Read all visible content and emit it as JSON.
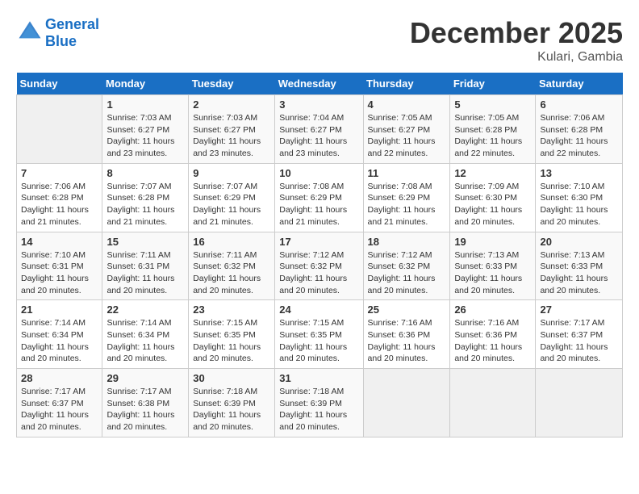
{
  "header": {
    "logo_line1": "General",
    "logo_line2": "Blue",
    "title": "December 2025",
    "subtitle": "Kulari, Gambia"
  },
  "days_of_week": [
    "Sunday",
    "Monday",
    "Tuesday",
    "Wednesday",
    "Thursday",
    "Friday",
    "Saturday"
  ],
  "weeks": [
    [
      {
        "day": "",
        "sunrise": "",
        "sunset": "",
        "daylight": ""
      },
      {
        "day": "1",
        "sunrise": "Sunrise: 7:03 AM",
        "sunset": "Sunset: 6:27 PM",
        "daylight": "Daylight: 11 hours and 23 minutes."
      },
      {
        "day": "2",
        "sunrise": "Sunrise: 7:03 AM",
        "sunset": "Sunset: 6:27 PM",
        "daylight": "Daylight: 11 hours and 23 minutes."
      },
      {
        "day": "3",
        "sunrise": "Sunrise: 7:04 AM",
        "sunset": "Sunset: 6:27 PM",
        "daylight": "Daylight: 11 hours and 23 minutes."
      },
      {
        "day": "4",
        "sunrise": "Sunrise: 7:05 AM",
        "sunset": "Sunset: 6:27 PM",
        "daylight": "Daylight: 11 hours and 22 minutes."
      },
      {
        "day": "5",
        "sunrise": "Sunrise: 7:05 AM",
        "sunset": "Sunset: 6:28 PM",
        "daylight": "Daylight: 11 hours and 22 minutes."
      },
      {
        "day": "6",
        "sunrise": "Sunrise: 7:06 AM",
        "sunset": "Sunset: 6:28 PM",
        "daylight": "Daylight: 11 hours and 22 minutes."
      }
    ],
    [
      {
        "day": "7",
        "sunrise": "Sunrise: 7:06 AM",
        "sunset": "Sunset: 6:28 PM",
        "daylight": "Daylight: 11 hours and 21 minutes."
      },
      {
        "day": "8",
        "sunrise": "Sunrise: 7:07 AM",
        "sunset": "Sunset: 6:28 PM",
        "daylight": "Daylight: 11 hours and 21 minutes."
      },
      {
        "day": "9",
        "sunrise": "Sunrise: 7:07 AM",
        "sunset": "Sunset: 6:29 PM",
        "daylight": "Daylight: 11 hours and 21 minutes."
      },
      {
        "day": "10",
        "sunrise": "Sunrise: 7:08 AM",
        "sunset": "Sunset: 6:29 PM",
        "daylight": "Daylight: 11 hours and 21 minutes."
      },
      {
        "day": "11",
        "sunrise": "Sunrise: 7:08 AM",
        "sunset": "Sunset: 6:29 PM",
        "daylight": "Daylight: 11 hours and 21 minutes."
      },
      {
        "day": "12",
        "sunrise": "Sunrise: 7:09 AM",
        "sunset": "Sunset: 6:30 PM",
        "daylight": "Daylight: 11 hours and 20 minutes."
      },
      {
        "day": "13",
        "sunrise": "Sunrise: 7:10 AM",
        "sunset": "Sunset: 6:30 PM",
        "daylight": "Daylight: 11 hours and 20 minutes."
      }
    ],
    [
      {
        "day": "14",
        "sunrise": "Sunrise: 7:10 AM",
        "sunset": "Sunset: 6:31 PM",
        "daylight": "Daylight: 11 hours and 20 minutes."
      },
      {
        "day": "15",
        "sunrise": "Sunrise: 7:11 AM",
        "sunset": "Sunset: 6:31 PM",
        "daylight": "Daylight: 11 hours and 20 minutes."
      },
      {
        "day": "16",
        "sunrise": "Sunrise: 7:11 AM",
        "sunset": "Sunset: 6:32 PM",
        "daylight": "Daylight: 11 hours and 20 minutes."
      },
      {
        "day": "17",
        "sunrise": "Sunrise: 7:12 AM",
        "sunset": "Sunset: 6:32 PM",
        "daylight": "Daylight: 11 hours and 20 minutes."
      },
      {
        "day": "18",
        "sunrise": "Sunrise: 7:12 AM",
        "sunset": "Sunset: 6:32 PM",
        "daylight": "Daylight: 11 hours and 20 minutes."
      },
      {
        "day": "19",
        "sunrise": "Sunrise: 7:13 AM",
        "sunset": "Sunset: 6:33 PM",
        "daylight": "Daylight: 11 hours and 20 minutes."
      },
      {
        "day": "20",
        "sunrise": "Sunrise: 7:13 AM",
        "sunset": "Sunset: 6:33 PM",
        "daylight": "Daylight: 11 hours and 20 minutes."
      }
    ],
    [
      {
        "day": "21",
        "sunrise": "Sunrise: 7:14 AM",
        "sunset": "Sunset: 6:34 PM",
        "daylight": "Daylight: 11 hours and 20 minutes."
      },
      {
        "day": "22",
        "sunrise": "Sunrise: 7:14 AM",
        "sunset": "Sunset: 6:34 PM",
        "daylight": "Daylight: 11 hours and 20 minutes."
      },
      {
        "day": "23",
        "sunrise": "Sunrise: 7:15 AM",
        "sunset": "Sunset: 6:35 PM",
        "daylight": "Daylight: 11 hours and 20 minutes."
      },
      {
        "day": "24",
        "sunrise": "Sunrise: 7:15 AM",
        "sunset": "Sunset: 6:35 PM",
        "daylight": "Daylight: 11 hours and 20 minutes."
      },
      {
        "day": "25",
        "sunrise": "Sunrise: 7:16 AM",
        "sunset": "Sunset: 6:36 PM",
        "daylight": "Daylight: 11 hours and 20 minutes."
      },
      {
        "day": "26",
        "sunrise": "Sunrise: 7:16 AM",
        "sunset": "Sunset: 6:36 PM",
        "daylight": "Daylight: 11 hours and 20 minutes."
      },
      {
        "day": "27",
        "sunrise": "Sunrise: 7:17 AM",
        "sunset": "Sunset: 6:37 PM",
        "daylight": "Daylight: 11 hours and 20 minutes."
      }
    ],
    [
      {
        "day": "28",
        "sunrise": "Sunrise: 7:17 AM",
        "sunset": "Sunset: 6:37 PM",
        "daylight": "Daylight: 11 hours and 20 minutes."
      },
      {
        "day": "29",
        "sunrise": "Sunrise: 7:17 AM",
        "sunset": "Sunset: 6:38 PM",
        "daylight": "Daylight: 11 hours and 20 minutes."
      },
      {
        "day": "30",
        "sunrise": "Sunrise: 7:18 AM",
        "sunset": "Sunset: 6:39 PM",
        "daylight": "Daylight: 11 hours and 20 minutes."
      },
      {
        "day": "31",
        "sunrise": "Sunrise: 7:18 AM",
        "sunset": "Sunset: 6:39 PM",
        "daylight": "Daylight: 11 hours and 20 minutes."
      },
      {
        "day": "",
        "sunrise": "",
        "sunset": "",
        "daylight": ""
      },
      {
        "day": "",
        "sunrise": "",
        "sunset": "",
        "daylight": ""
      },
      {
        "day": "",
        "sunrise": "",
        "sunset": "",
        "daylight": ""
      }
    ]
  ]
}
